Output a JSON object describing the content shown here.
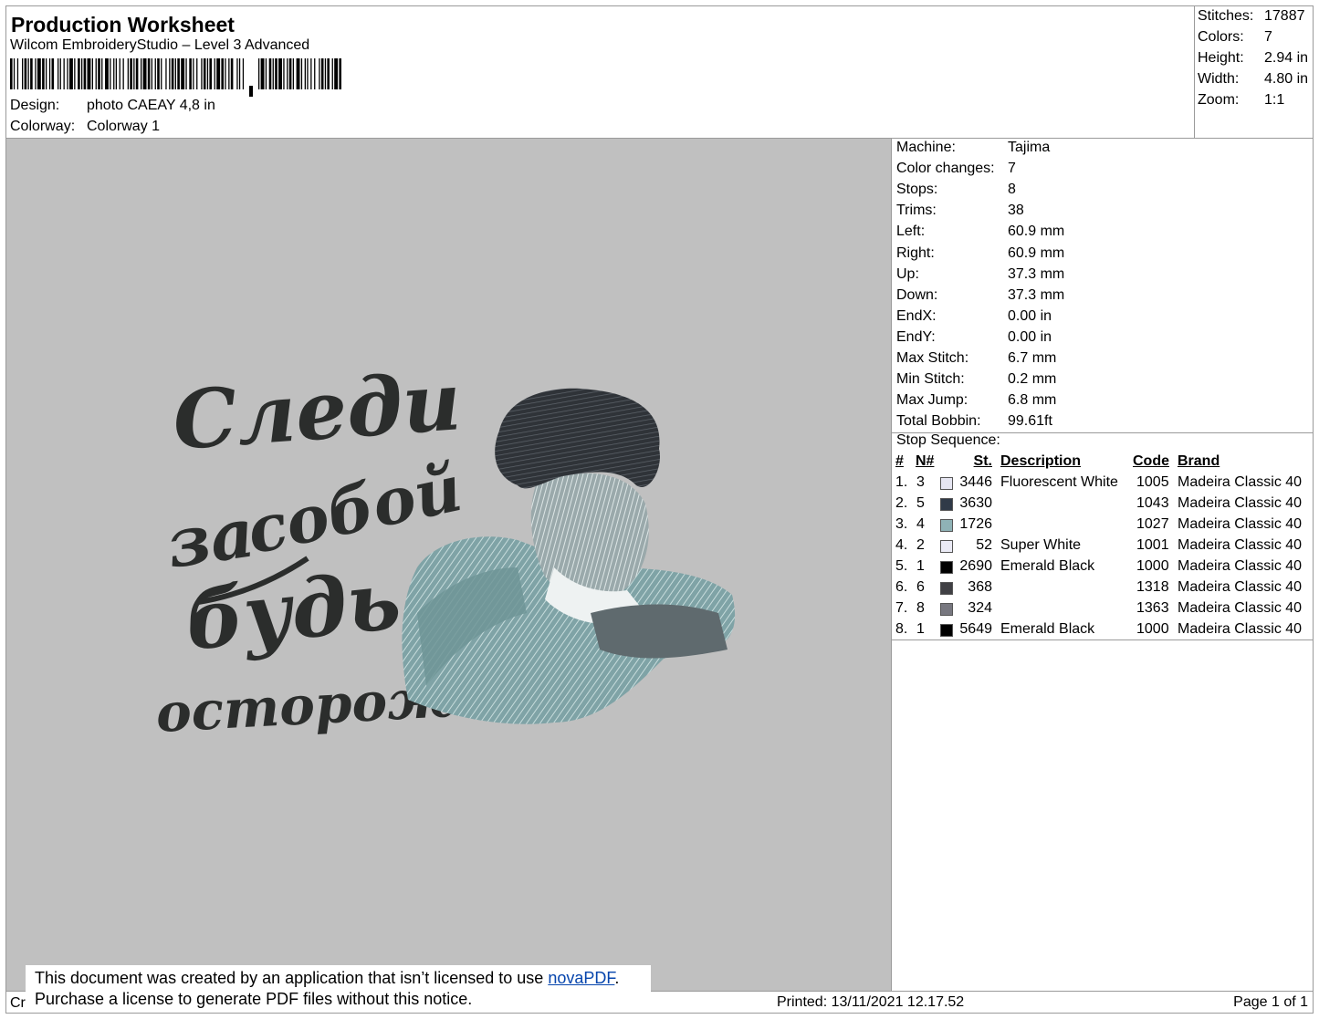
{
  "header": {
    "title": "Production Worksheet",
    "software": "Wilcom EmbroideryStudio – Level 3 Advanced",
    "design_label": "Design:",
    "design_value": "photo CAEAY 4,8 in",
    "colorway_label": "Colorway:",
    "colorway_value": "Colorway 1"
  },
  "stats": [
    {
      "label": "Stitches:",
      "value": "17887"
    },
    {
      "label": "Colors:",
      "value": "7"
    },
    {
      "label": "Height:",
      "value": "2.94 in"
    },
    {
      "label": "Width:",
      "value": "4.80 in"
    },
    {
      "label": "Zoom:",
      "value": "1:1"
    }
  ],
  "machine_info": [
    {
      "label": "Machine:",
      "value": "Tajima"
    },
    {
      "label": "Color changes:",
      "value": "7"
    },
    {
      "label": "Stops:",
      "value": "8"
    },
    {
      "label": "Trims:",
      "value": "38"
    },
    {
      "label": "Left:",
      "value": "60.9 mm"
    },
    {
      "label": "Right:",
      "value": "60.9 mm"
    },
    {
      "label": "Up:",
      "value": "37.3 mm"
    },
    {
      "label": "Down:",
      "value": "37.3 mm"
    },
    {
      "label": "EndX:",
      "value": "0.00 in"
    },
    {
      "label": "EndY:",
      "value": "0.00 in"
    },
    {
      "label": "Max Stitch:",
      "value": "6.7 mm"
    },
    {
      "label": "Min Stitch:",
      "value": "0.2 mm"
    },
    {
      "label": "Max Jump:",
      "value": "6.8 mm"
    },
    {
      "label": "Total Bobbin:",
      "value": "99.61ft"
    }
  ],
  "stop_sequence": {
    "title": "Stop Sequence:",
    "headers": [
      "#",
      "N#",
      "St.",
      "Description",
      "Code",
      "Brand"
    ],
    "rows": [
      {
        "num": "1.",
        "n": "3",
        "color": "#e6e6f2",
        "st": "3446",
        "desc": "Fluorescent White",
        "code": "1005",
        "brand": "Madeira Classic 40"
      },
      {
        "num": "2.",
        "n": "5",
        "color": "#303a48",
        "st": "3630",
        "desc": "",
        "code": "1043",
        "brand": "Madeira Classic 40"
      },
      {
        "num": "3.",
        "n": "4",
        "color": "#8fb2b6",
        "st": "1726",
        "desc": "",
        "code": "1027",
        "brand": "Madeira Classic 40"
      },
      {
        "num": "4.",
        "n": "2",
        "color": "#ebebf6",
        "st": "52",
        "desc": "Super White",
        "code": "1001",
        "brand": "Madeira Classic 40"
      },
      {
        "num": "5.",
        "n": "1",
        "color": "#000000",
        "st": "2690",
        "desc": "Emerald Black",
        "code": "1000",
        "brand": "Madeira Classic 40"
      },
      {
        "num": "6.",
        "n": "6",
        "color": "#404044",
        "st": "368",
        "desc": "",
        "code": "1318",
        "brand": "Madeira Classic 40"
      },
      {
        "num": "7.",
        "n": "8",
        "color": "#77777f",
        "st": "324",
        "desc": "",
        "code": "1363",
        "brand": "Madeira Classic 40"
      },
      {
        "num": "8.",
        "n": "1",
        "color": "#000000",
        "st": "5649",
        "desc": "Emerald Black",
        "code": "1000",
        "brand": "Madeira Classic 40"
      }
    ]
  },
  "preview": {
    "background": "#c0c0c0",
    "text_lines": [
      "Следи",
      "за",
      "собой",
      "будь",
      "осторожен"
    ]
  },
  "footer": {
    "cr": "Cr",
    "printed": "Printed: 13/11/2021 12.17.52",
    "page": "Page 1 of 1"
  },
  "notice": {
    "line1_pre": "This document was created by an application that isn’t licensed to use ",
    "link": "novaPDF",
    "line1_post": ".",
    "line2": "Purchase a license to generate PDF files without this notice."
  }
}
